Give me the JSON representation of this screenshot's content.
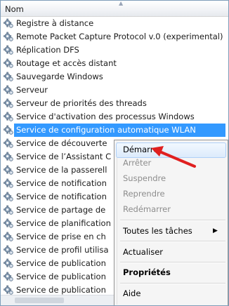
{
  "header": {
    "column_label": "Nom"
  },
  "services": [
    "Registre à distance",
    "Remote Packet Capture Protocol v.0 (experimental)",
    "Réplication DFS",
    "Routage et accès distant",
    "Sauvegarde Windows",
    "Serveur",
    "Serveur de priorités des threads",
    "Service d'activation des processus Windows",
    "Service de configuration automatique WLAN",
    "Service de découverte",
    "Service de l’Assistant C",
    "Service de la passerell",
    "Service de notification",
    "Service de notification",
    "Service de partage de",
    "Service de planification",
    "Service de prise en ch",
    "Service de profil utilisa",
    "Service de publication",
    "Service de publication",
    "Service de publication"
  ],
  "selected_index": 8,
  "context_menu": {
    "start": "Démarrer",
    "stop": "Arrêter",
    "pause": "Suspendre",
    "resume": "Reprendre",
    "restart": "Redémarrer",
    "all_tasks": "Toutes les tâches",
    "refresh": "Actualiser",
    "properties": "Propriétés",
    "help": "Aide"
  },
  "colors": {
    "selection": "#3399ff",
    "annotation_arrow": "#e02020"
  }
}
